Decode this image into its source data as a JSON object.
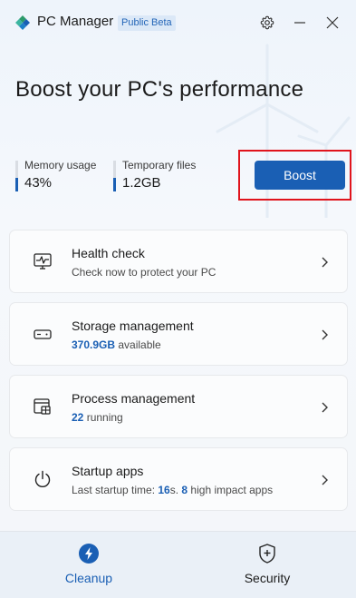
{
  "titlebar": {
    "app_title": "PC Manager",
    "badge": "Public Beta",
    "icons": [
      "logo-icon",
      "gear-icon",
      "minimize-icon",
      "close-icon"
    ]
  },
  "hero": {
    "title": "Boost your PC's performance",
    "memory": {
      "label": "Memory usage",
      "value": "43%",
      "level": 0.43
    },
    "temp": {
      "label": "Temporary files",
      "value": "1.2GB",
      "level": 0.43
    },
    "boost_label": "Boost"
  },
  "cards": [
    {
      "title": "Health check",
      "subtitle": "Check now to protect your PC",
      "icon": "health-monitor-icon"
    },
    {
      "title": "Storage management",
      "value": "370.9GB",
      "suffix": " available",
      "icon": "storage-drive-icon"
    },
    {
      "title": "Process management",
      "value": "22",
      "suffix": " running",
      "icon": "process-window-icon"
    },
    {
      "title": "Startup apps",
      "prefix": "Last startup time: ",
      "time_value": "16",
      "time_unit": "s. ",
      "count_value": "8",
      "count_suffix": " high impact apps",
      "icon": "power-icon"
    }
  ],
  "nav": {
    "cleanup": "Cleanup",
    "security": "Security"
  },
  "colors": {
    "accent": "#1a5fb4",
    "highlight_frame": "#e0141c"
  }
}
